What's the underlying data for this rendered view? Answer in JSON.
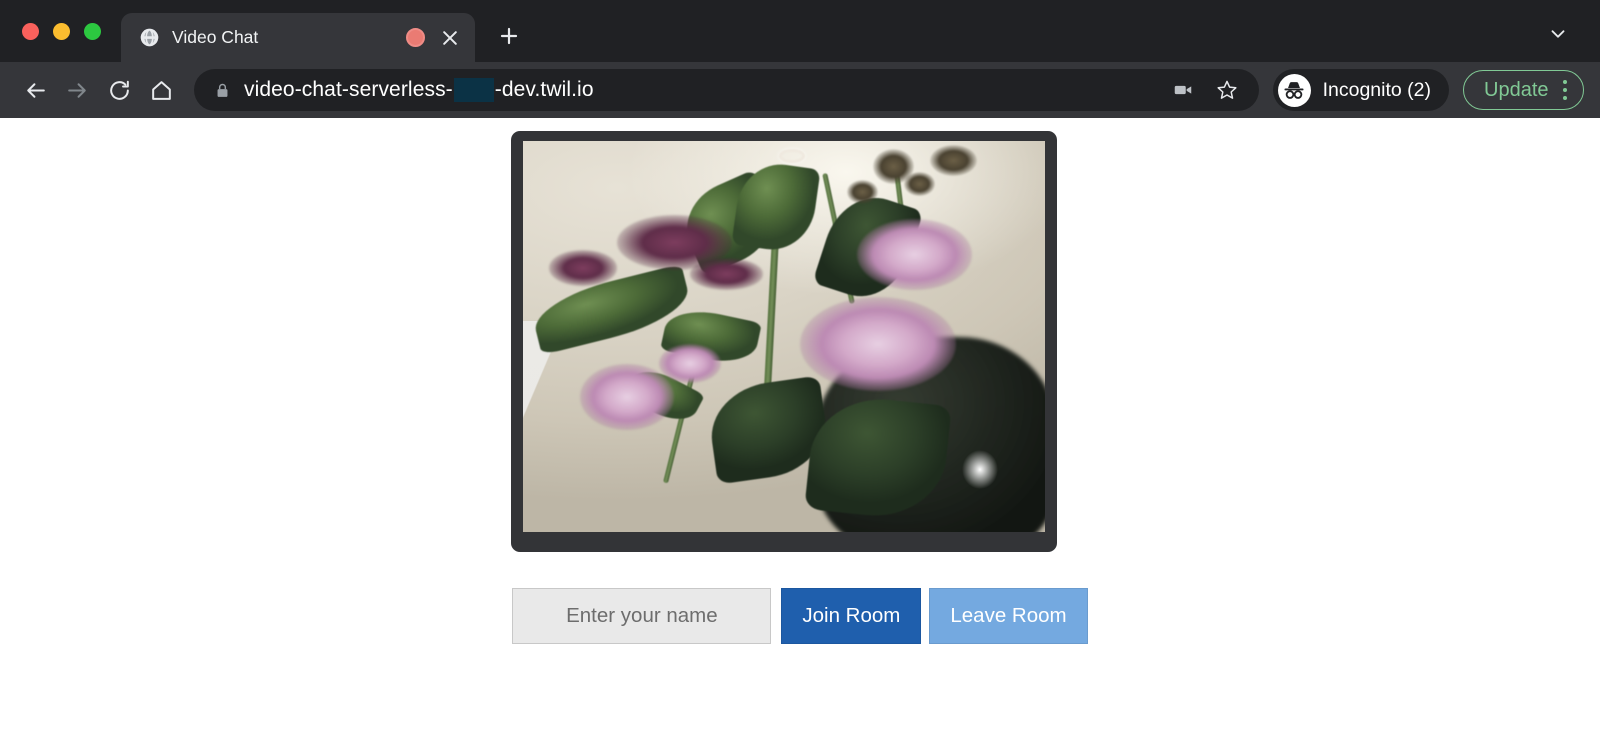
{
  "window": {
    "traffic_lights": [
      "close",
      "minimize",
      "maximize"
    ]
  },
  "tabstrip": {
    "tabs": [
      {
        "favicon": "globe-icon",
        "title": "Video Chat",
        "recording_indicator": "recording-dot-icon",
        "close": "close-icon"
      }
    ],
    "new_tab": "plus-icon",
    "tab_search": "chevron-down-icon"
  },
  "toolbar": {
    "back": "back-arrow-icon",
    "forward": "forward-arrow-icon",
    "reload": "reload-icon",
    "home": "home-icon",
    "omnibox": {
      "security": "lock-icon",
      "url_prefix": "video-chat-serverless-",
      "url_redacted": "",
      "url_suffix": "-dev.twil.io",
      "full_url": "video-chat-serverless-███-dev.twil.io",
      "media_indicator": "video-camera-icon",
      "bookmark": "star-icon"
    },
    "profile": {
      "avatar": "incognito-icon",
      "label": "Incognito (2)"
    },
    "update": {
      "label": "Update",
      "menu": "kebab-menu-icon"
    },
    "colors": {
      "chrome_bg": "#35363a",
      "tabstrip_bg": "#202124",
      "omnibox_bg": "#202124",
      "update_accent": "#81c995"
    }
  },
  "page": {
    "background": "#ffffff",
    "video": {
      "label": "local-video-preview",
      "frame_color": "#333437",
      "description": "Live webcam preview showing pink and lavender flowers with green leaves in a dark vase against a beige wall"
    },
    "controls": {
      "name_input_placeholder": "Enter your name",
      "name_input_value": "",
      "join_label": "Join Room",
      "leave_label": "Leave Room",
      "join_color": "#1f5fad",
      "leave_color": "#74a9e0",
      "input_bg": "#e9e9e9"
    }
  }
}
